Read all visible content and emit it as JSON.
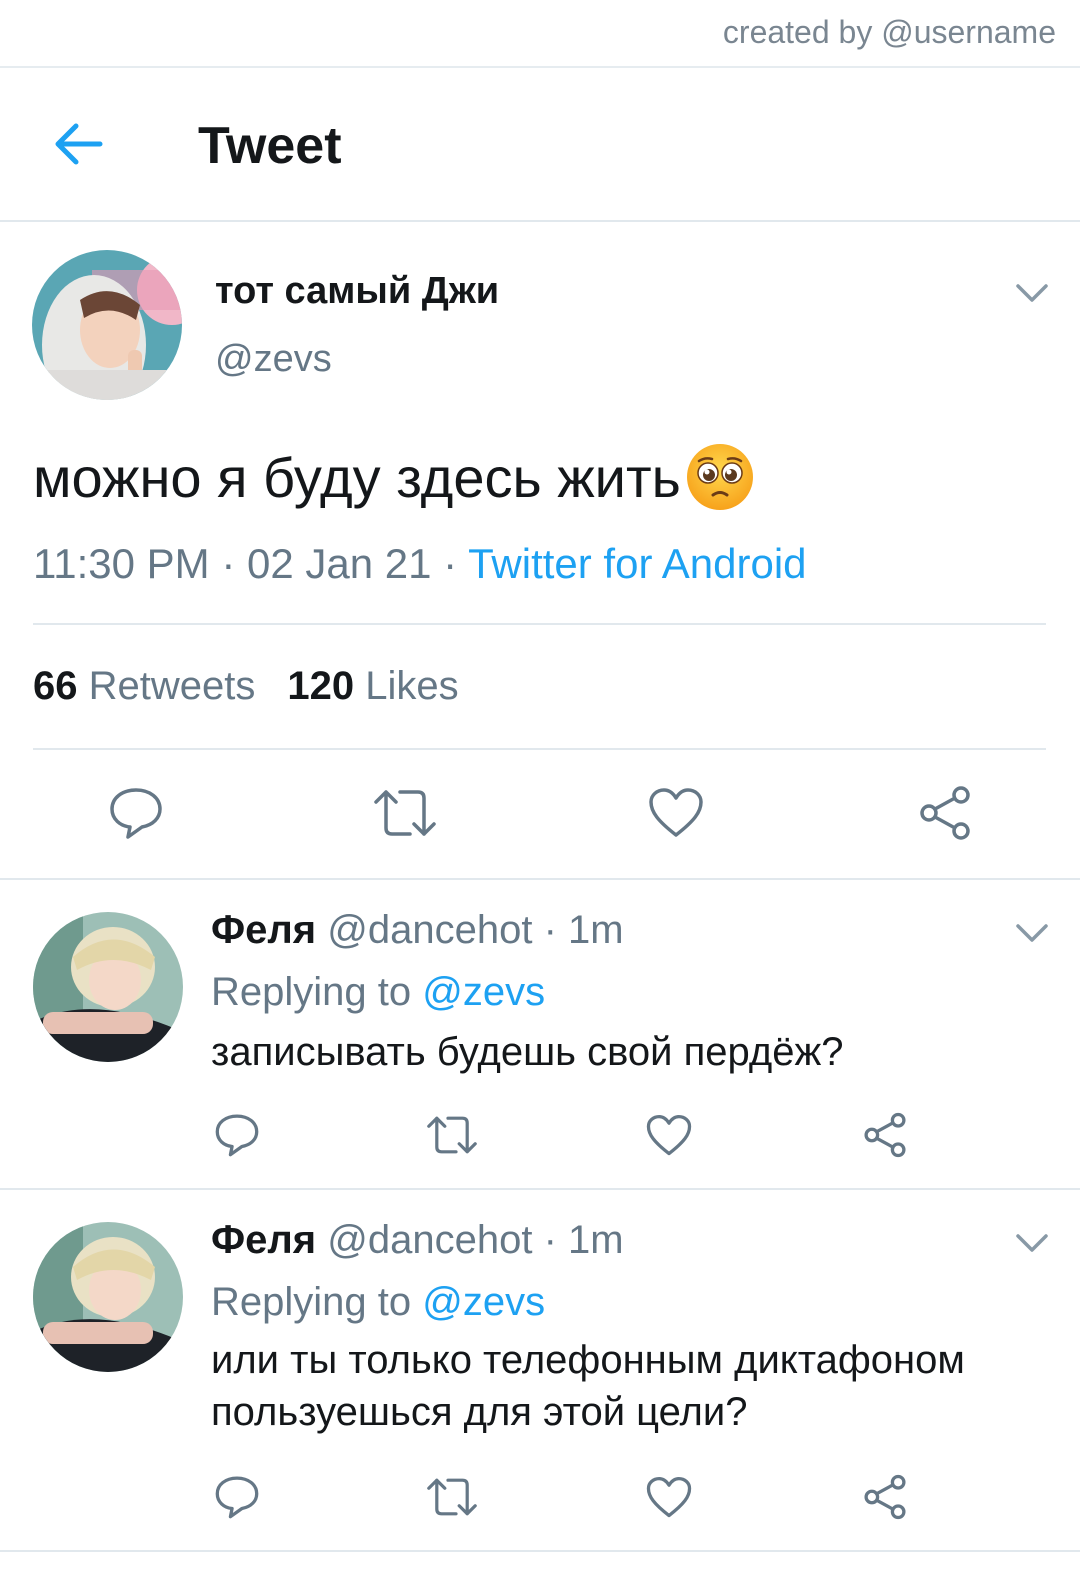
{
  "watermark": "created by @username",
  "header": {
    "title": "Tweet"
  },
  "tweet": {
    "display_name": "тот самый Джи",
    "handle": "@zevs",
    "text": "можно я буду здесь жить",
    "time": "11:30 PM",
    "date": "02 Jan 21",
    "source": "Twitter for Android",
    "retweets_count": "66",
    "retweets_label": "Retweets",
    "likes_count": "120",
    "likes_label": "Likes"
  },
  "replies": [
    {
      "display_name": "Феля",
      "handle": "@dancehot",
      "age": "1m",
      "replying_prefix": "Replying to",
      "replying_to": "@zevs",
      "text": "записывать будешь свой пердёж?"
    },
    {
      "display_name": "Феля",
      "handle": "@dancehot",
      "age": "1m",
      "replying_prefix": "Replying to",
      "replying_to": "@zevs",
      "text": "или ты только телефонным диктафоном пользуешься для этой цели?"
    }
  ],
  "icons": [
    "back-arrow-icon",
    "chevron-down-icon",
    "reply-icon",
    "retweet-icon",
    "like-icon",
    "share-icon",
    "pleading-face-emoji"
  ],
  "colors": {
    "accent": "#1da1f2",
    "secondary_text": "#657786",
    "divider": "#e1e8ed"
  }
}
